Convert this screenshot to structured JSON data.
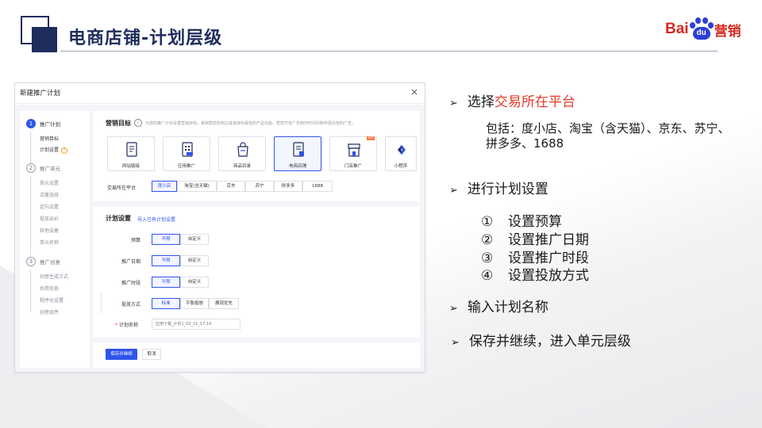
{
  "slide": {
    "title": "电商店铺-计划层级",
    "logo": {
      "text_left": "Bai",
      "paw_text": "du",
      "text_right": "营销"
    }
  },
  "dialog": {
    "title": "新建推广计划",
    "close": "×",
    "steps": [
      {
        "num": "1",
        "label": "推广计划",
        "subs": [
          "营销目标",
          "计划设置"
        ]
      },
      {
        "num": "2",
        "label": "推广单元",
        "subs": [
          "单元设置",
          "流量选择",
          "定向设置",
          "投放出价",
          "其他设备",
          "单元名称"
        ]
      },
      {
        "num": "3",
        "label": "推广创意",
        "subs": [
          "创意生成方式",
          "共用信息",
          "程序化设置",
          "创意组件"
        ]
      }
    ],
    "help_mark": "?",
    "marketing": {
      "title": "营销目标",
      "info_mark": "i",
      "desc": "为您的推广计划设置营销目标，系统帮您找到达成该目标最佳的产品功能，帮您节省广告制作时间并制作更出色的广告。",
      "tiles": [
        "网站链接",
        "应用推广",
        "商品目录",
        "电商店铺",
        "门店推广",
        "小程序"
      ],
      "ribbon": "APP",
      "selected": "电商店铺",
      "platform_label": "交易所在平台",
      "platforms": [
        "度小店",
        "淘宝(含天猫)",
        "京东",
        "苏宁",
        "拼多多",
        "1688"
      ],
      "platform_selected": "度小店"
    },
    "plan": {
      "title": "计划设置",
      "import_link": "导入已有计划设置",
      "budget": {
        "label": "预算",
        "options": [
          "不限",
          "自定义"
        ]
      },
      "date": {
        "label": "推广日期",
        "options": [
          "不限",
          "自定义"
        ]
      },
      "time": {
        "label": "推广时段",
        "options": [
          "不限",
          "自定义"
        ]
      },
      "delivery": {
        "label": "投放方式",
        "options": [
          "标准",
          "平衡投放",
          "展现优先"
        ]
      },
      "name": {
        "label": "计划名称",
        "required_mark": "*",
        "placeholder": "应用下载_计划1_02_21_17:14"
      }
    },
    "footer": {
      "save": "保存并继续",
      "cancel": "取消"
    }
  },
  "bullets": {
    "arrow": "➢",
    "b1_prefix": "选择",
    "b1_highlight": "交易所在平台",
    "b1_detail": "包括：度小店、淘宝（含天猫）、京东、苏宁、拼多多、1688",
    "b2": "进行计划设置",
    "sub_items": [
      {
        "num": "①",
        "text": "设置预算"
      },
      {
        "num": "②",
        "text": "设置推广日期"
      },
      {
        "num": "③",
        "text": "设置推广时段"
      },
      {
        "num": "④",
        "text": "设置投放方式"
      }
    ],
    "b3": "输入计划名称",
    "b4": "保存并继续，进入单元层级"
  },
  "colors": {
    "navy": "#1f2d5c",
    "accent_blue": "#2f54eb",
    "highlight_red": "#e23b2a",
    "baidu_red": "#d82a20",
    "baidu_blue": "#2d3fd6"
  }
}
